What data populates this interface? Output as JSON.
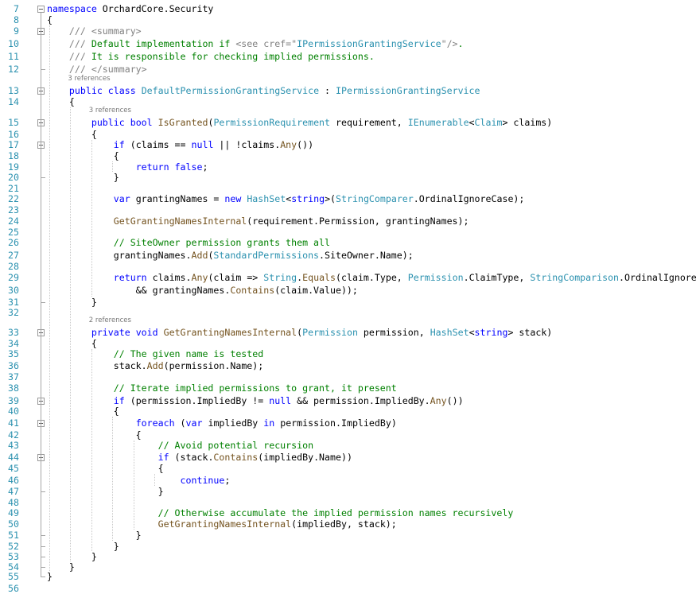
{
  "editor": {
    "lines": [
      {
        "num": "7",
        "tokens": [
          {
            "t": "namespace",
            "c": "kw"
          },
          {
            "t": " OrchardCore.Security"
          }
        ]
      },
      {
        "num": "8",
        "tokens": [
          {
            "t": "{"
          }
        ]
      },
      {
        "num": "9",
        "tokens": [
          {
            "t": "    "
          },
          {
            "t": "/// ",
            "c": "xd"
          },
          {
            "t": "<summary>",
            "c": "xd"
          }
        ]
      },
      {
        "num": "10",
        "tokens": [
          {
            "t": "    "
          },
          {
            "t": "/// ",
            "c": "xd"
          },
          {
            "t": "Default implementation if ",
            "c": "cm"
          },
          {
            "t": "<see cref=\"",
            "c": "xd"
          },
          {
            "t": "IPermissionGrantingService",
            "c": "ty"
          },
          {
            "t": "\"/>",
            "c": "xd"
          },
          {
            "t": ".",
            "c": "cm"
          }
        ]
      },
      {
        "num": "11",
        "tokens": [
          {
            "t": "    "
          },
          {
            "t": "/// ",
            "c": "xd"
          },
          {
            "t": "It is responsible for checking implied permissions.",
            "c": "cm"
          }
        ]
      },
      {
        "num": "12",
        "tokens": [
          {
            "t": "    "
          },
          {
            "t": "/// ",
            "c": "xd"
          },
          {
            "t": "</summary>",
            "c": "xd"
          }
        ]
      },
      {
        "num": "13",
        "tokens": [
          {
            "t": "    "
          },
          {
            "t": "public",
            "c": "kw"
          },
          {
            "t": " "
          },
          {
            "t": "class",
            "c": "kw"
          },
          {
            "t": " "
          },
          {
            "t": "DefaultPermissionGrantingService",
            "c": "ty"
          },
          {
            "t": " : "
          },
          {
            "t": "IPermissionGrantingService",
            "c": "ty"
          }
        ]
      },
      {
        "num": "14",
        "tokens": [
          {
            "t": "    {"
          }
        ]
      },
      {
        "num": "15",
        "tokens": [
          {
            "t": "        "
          },
          {
            "t": "public",
            "c": "kw"
          },
          {
            "t": " "
          },
          {
            "t": "bool",
            "c": "kw"
          },
          {
            "t": " "
          },
          {
            "t": "IsGranted",
            "c": "fn"
          },
          {
            "t": "("
          },
          {
            "t": "PermissionRequirement",
            "c": "ty"
          },
          {
            "t": " requirement, "
          },
          {
            "t": "IEnumerable",
            "c": "ty"
          },
          {
            "t": "<"
          },
          {
            "t": "Claim",
            "c": "ty"
          },
          {
            "t": "> claims)"
          }
        ]
      },
      {
        "num": "16",
        "tokens": [
          {
            "t": "        {"
          }
        ]
      },
      {
        "num": "17",
        "tokens": [
          {
            "t": "            "
          },
          {
            "t": "if",
            "c": "kw"
          },
          {
            "t": " (claims == "
          },
          {
            "t": "null",
            "c": "kw"
          },
          {
            "t": " || !claims."
          },
          {
            "t": "Any",
            "c": "fn"
          },
          {
            "t": "())"
          }
        ]
      },
      {
        "num": "18",
        "tokens": [
          {
            "t": "            {"
          }
        ]
      },
      {
        "num": "19",
        "tokens": [
          {
            "t": "                "
          },
          {
            "t": "return",
            "c": "kw"
          },
          {
            "t": " "
          },
          {
            "t": "false",
            "c": "kw"
          },
          {
            "t": ";"
          }
        ]
      },
      {
        "num": "20",
        "tokens": [
          {
            "t": "            }"
          }
        ]
      },
      {
        "num": "21",
        "tokens": []
      },
      {
        "num": "22",
        "tokens": [
          {
            "t": "            "
          },
          {
            "t": "var",
            "c": "kw"
          },
          {
            "t": " grantingNames = "
          },
          {
            "t": "new",
            "c": "kw"
          },
          {
            "t": " "
          },
          {
            "t": "HashSet",
            "c": "ty"
          },
          {
            "t": "<"
          },
          {
            "t": "string",
            "c": "kw"
          },
          {
            "t": ">("
          },
          {
            "t": "StringComparer",
            "c": "ty"
          },
          {
            "t": ".OrdinalIgnoreCase);"
          }
        ]
      },
      {
        "num": "23",
        "tokens": []
      },
      {
        "num": "24",
        "tokens": [
          {
            "t": "            "
          },
          {
            "t": "GetGrantingNamesInternal",
            "c": "fn"
          },
          {
            "t": "(requirement.Permission, grantingNames);"
          }
        ]
      },
      {
        "num": "25",
        "tokens": []
      },
      {
        "num": "26",
        "tokens": [
          {
            "t": "            "
          },
          {
            "t": "// SiteOwner permission grants them all",
            "c": "cm"
          }
        ]
      },
      {
        "num": "27",
        "tokens": [
          {
            "t": "            grantingNames."
          },
          {
            "t": "Add",
            "c": "fn"
          },
          {
            "t": "("
          },
          {
            "t": "StandardPermissions",
            "c": "ty"
          },
          {
            "t": ".SiteOwner.Name);"
          }
        ]
      },
      {
        "num": "28",
        "tokens": []
      },
      {
        "num": "29",
        "tokens": [
          {
            "t": "            "
          },
          {
            "t": "return",
            "c": "kw"
          },
          {
            "t": " claims."
          },
          {
            "t": "Any",
            "c": "fn"
          },
          {
            "t": "(claim => "
          },
          {
            "t": "String",
            "c": "ty"
          },
          {
            "t": "."
          },
          {
            "t": "Equals",
            "c": "fn"
          },
          {
            "t": "(claim.Type, "
          },
          {
            "t": "Permission",
            "c": "ty"
          },
          {
            "t": ".ClaimType, "
          },
          {
            "t": "StringComparison",
            "c": "ty"
          },
          {
            "t": ".OrdinalIgnoreCase)"
          }
        ]
      },
      {
        "num": "30",
        "tokens": [
          {
            "t": "                && grantingNames."
          },
          {
            "t": "Contains",
            "c": "fn"
          },
          {
            "t": "(claim.Value));"
          }
        ]
      },
      {
        "num": "31",
        "tokens": [
          {
            "t": "        }"
          }
        ]
      },
      {
        "num": "32",
        "tokens": []
      },
      {
        "num": "33",
        "tokens": [
          {
            "t": "        "
          },
          {
            "t": "private",
            "c": "kw"
          },
          {
            "t": " "
          },
          {
            "t": "void",
            "c": "kw"
          },
          {
            "t": " "
          },
          {
            "t": "GetGrantingNamesInternal",
            "c": "fn"
          },
          {
            "t": "("
          },
          {
            "t": "Permission",
            "c": "ty"
          },
          {
            "t": " permission, "
          },
          {
            "t": "HashSet",
            "c": "ty"
          },
          {
            "t": "<"
          },
          {
            "t": "string",
            "c": "kw"
          },
          {
            "t": "> stack)"
          }
        ]
      },
      {
        "num": "34",
        "tokens": [
          {
            "t": "        {"
          }
        ]
      },
      {
        "num": "35",
        "tokens": [
          {
            "t": "            "
          },
          {
            "t": "// The given name is tested",
            "c": "cm"
          }
        ]
      },
      {
        "num": "36",
        "tokens": [
          {
            "t": "            stack."
          },
          {
            "t": "Add",
            "c": "fn"
          },
          {
            "t": "(permission.Name);"
          }
        ]
      },
      {
        "num": "37",
        "tokens": []
      },
      {
        "num": "38",
        "tokens": [
          {
            "t": "            "
          },
          {
            "t": "// Iterate implied permissions to grant, it present",
            "c": "cm"
          }
        ]
      },
      {
        "num": "39",
        "tokens": [
          {
            "t": "            "
          },
          {
            "t": "if",
            "c": "kw"
          },
          {
            "t": " (permission.ImpliedBy != "
          },
          {
            "t": "null",
            "c": "kw"
          },
          {
            "t": " && permission.ImpliedBy."
          },
          {
            "t": "Any",
            "c": "fn"
          },
          {
            "t": "())"
          }
        ]
      },
      {
        "num": "40",
        "tokens": [
          {
            "t": "            {"
          }
        ]
      },
      {
        "num": "41",
        "tokens": [
          {
            "t": "                "
          },
          {
            "t": "foreach",
            "c": "kw"
          },
          {
            "t": " ("
          },
          {
            "t": "var",
            "c": "kw"
          },
          {
            "t": " impliedBy "
          },
          {
            "t": "in",
            "c": "kw"
          },
          {
            "t": " permission.ImpliedBy)"
          }
        ]
      },
      {
        "num": "42",
        "tokens": [
          {
            "t": "                {"
          }
        ]
      },
      {
        "num": "43",
        "tokens": [
          {
            "t": "                    "
          },
          {
            "t": "// Avoid potential recursion",
            "c": "cm"
          }
        ]
      },
      {
        "num": "44",
        "tokens": [
          {
            "t": "                    "
          },
          {
            "t": "if",
            "c": "kw"
          },
          {
            "t": " (stack."
          },
          {
            "t": "Contains",
            "c": "fn"
          },
          {
            "t": "(impliedBy.Name))"
          }
        ]
      },
      {
        "num": "45",
        "tokens": [
          {
            "t": "                    {"
          }
        ]
      },
      {
        "num": "46",
        "tokens": [
          {
            "t": "                        "
          },
          {
            "t": "continue",
            "c": "kw"
          },
          {
            "t": ";"
          }
        ]
      },
      {
        "num": "47",
        "tokens": [
          {
            "t": "                    }"
          }
        ]
      },
      {
        "num": "48",
        "tokens": []
      },
      {
        "num": "49",
        "tokens": [
          {
            "t": "                    "
          },
          {
            "t": "// Otherwise accumulate the implied permission names recursively",
            "c": "cm"
          }
        ]
      },
      {
        "num": "50",
        "tokens": [
          {
            "t": "                    "
          },
          {
            "t": "GetGrantingNamesInternal",
            "c": "fn"
          },
          {
            "t": "(impliedBy, stack);"
          }
        ]
      },
      {
        "num": "51",
        "tokens": [
          {
            "t": "                }"
          }
        ]
      },
      {
        "num": "52",
        "tokens": [
          {
            "t": "            }"
          }
        ]
      },
      {
        "num": "53",
        "tokens": [
          {
            "t": "        }"
          }
        ]
      },
      {
        "num": "54",
        "tokens": [
          {
            "t": "    }"
          }
        ]
      },
      {
        "num": "55",
        "tokens": [
          {
            "t": "}"
          }
        ]
      },
      {
        "num": "56",
        "tokens": []
      }
    ],
    "codelens": [
      {
        "before_line": "13",
        "text": "3 references",
        "indent": 4
      },
      {
        "before_line": "15",
        "text": "3 references",
        "indent": 8
      },
      {
        "before_line": "33",
        "text": "2 references",
        "indent": 8
      }
    ]
  },
  "theme": {
    "keyword": "#0000ff",
    "type": "#2b91af",
    "comment": "#008000",
    "xmldoc": "#808080",
    "method": "#74531f",
    "line_number": "#2b91af"
  }
}
